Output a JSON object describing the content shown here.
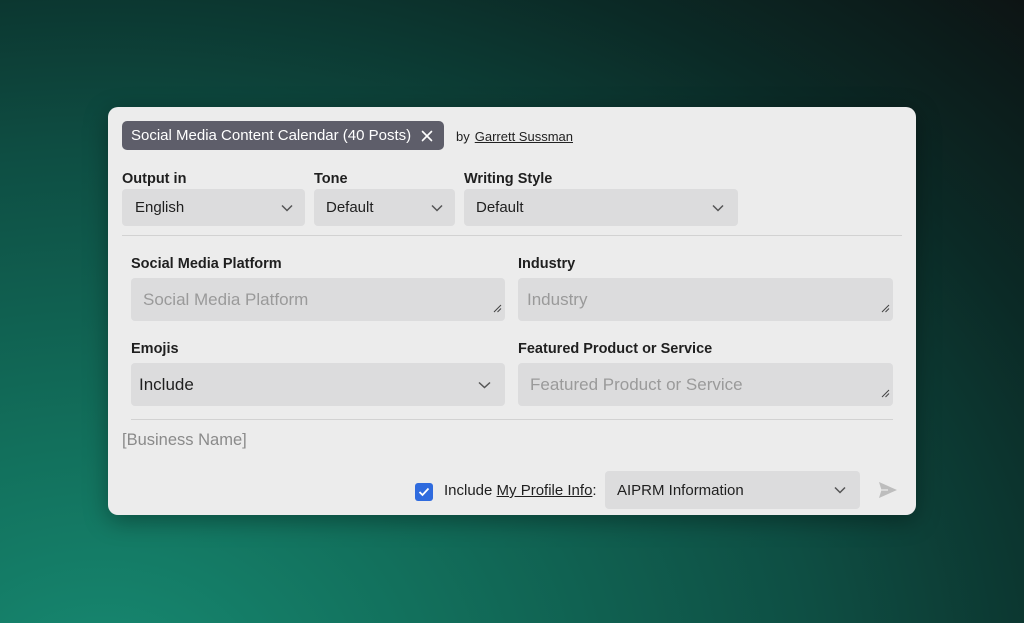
{
  "prompt": {
    "title": "Social Media Content Calendar (40 Posts)",
    "by_label": "by",
    "author": "Garrett Sussman"
  },
  "settings": {
    "output_label": "Output in",
    "output_value": "English",
    "tone_label": "Tone",
    "tone_value": "Default",
    "style_label": "Writing Style",
    "style_value": "Default"
  },
  "form": {
    "platform_label": "Social Media Platform",
    "platform_placeholder": "Social Media Platform",
    "industry_label": "Industry",
    "industry_placeholder": "Industry",
    "emojis_label": "Emojis",
    "emojis_value": "Include",
    "product_label": "Featured Product or Service",
    "product_placeholder": "Featured Product or Service"
  },
  "business_name": "[Business Name]",
  "footer": {
    "include_prefix": "Include ",
    "profile_link": "My Profile Info",
    "colon": ":",
    "profile_select": "AIPRM Information",
    "checked": true
  },
  "colors": {
    "checkbox": "#2f6bde",
    "chip": "#5e5e6a",
    "panel": "#ececec"
  }
}
